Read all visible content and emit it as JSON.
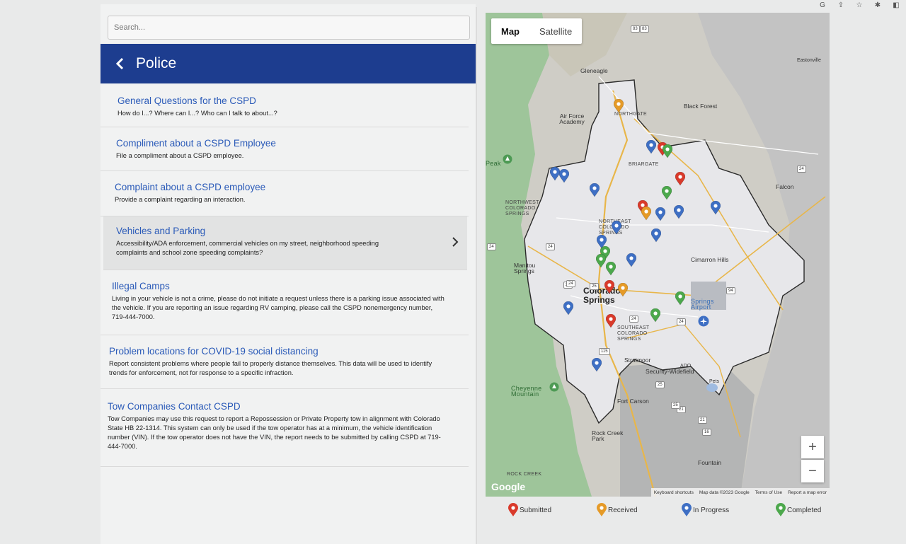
{
  "search": {
    "placeholder": "Search..."
  },
  "header": {
    "title": "Police"
  },
  "items": [
    {
      "title": "General Questions for the CSPD",
      "desc": "How do I...? Where can I...? Who can I talk to about...?"
    },
    {
      "title": "Compliment about a CSPD Employee",
      "desc": "File a compliment about a CSPD employee."
    },
    {
      "title": "Complaint about a CSPD employee",
      "desc": "Provide a complaint regarding an interaction."
    },
    {
      "title": "Vehicles and Parking",
      "desc": "Accessibility/ADA enforcement, commercial vehicles on my street, neighborhood speeding complaints and school zone speeding complaints?"
    },
    {
      "title": "Illegal Camps",
      "desc": "Living in your vehicle is not a crime, please do not initiate a request unless there is a parking issue associated with the vehicle. If you are reporting an issue regarding RV camping, please call the CSPD nonemergency number, 719-444-7000."
    },
    {
      "title": "Problem locations for COVID-19 social distancing",
      "desc": "Report consistent problems where people fail to properly distance themselves. This data will be used to identify trends for enforcement, not for response to a specific infraction."
    },
    {
      "title": "Tow Companies Contact CSPD",
      "desc": "Tow Companies may use this request to report a Repossession or Private Property tow in alignment with Colorado State HB 22-1314. This system can only be used if the tow operator has at a minimum, the vehicle identification number (VIN). If the tow operator does not have the VIN, the report needs to be submitted by calling CSPD at 719-444-7000."
    }
  ],
  "map": {
    "tabs": [
      "Map",
      "Satellite"
    ],
    "zoom_in": "+",
    "zoom_out": "−",
    "google": "Google",
    "attribution": [
      "Keyboard shortcuts",
      "Map data ©2023 Google",
      "Terms of Use",
      "Report a map error"
    ],
    "places": {
      "gleneagle": "Gleneagle",
      "eastonville": "Eastonville",
      "air_force": "Air Force Academy",
      "black_forest": "Black Forest",
      "northgate": "NORTHGATE",
      "briargate": "BRIARGATE",
      "falcon": "Falcon",
      "nw_springs": "NORTHWEST COLORADO SPRINGS",
      "ne_springs": "NORTHEAST COLORADO SPRINGS",
      "manitou": "Manitou Springs",
      "colorado_springs": "Colorado Springs",
      "cimarron": "Cimarron Hills",
      "airport": "Springs Airport",
      "se_springs": "SOUTHEAST COLORADO SPRINGS",
      "stratmoor": "Stratmoor",
      "security_widefield": "Security-Widefield",
      "cheyenne": "Cheyenne Mountain",
      "fort_carson": "Fort Carson",
      "rock_creek": "Rock Creek Park",
      "fountain": "Fountain",
      "rock_creek_small": "ROCK CREEK",
      "peak": "Peak",
      "ado": "ADO",
      "pets": "Pets"
    },
    "route_numbers": [
      "83",
      "24",
      "24",
      "24",
      "25",
      "24",
      "24",
      "115",
      "24",
      "94",
      "25",
      "21",
      "21",
      "16",
      "25",
      "83",
      "24"
    ]
  },
  "legend": [
    {
      "label": "Submitted",
      "color": "#d93a2b"
    },
    {
      "label": "Received",
      "color": "#e59a27"
    },
    {
      "label": "In Progress",
      "color": "#3e6fc4"
    },
    {
      "label": "Completed",
      "color": "#4ca84c"
    }
  ],
  "pins": [
    {
      "status": "Received",
      "color": "#e59a27"
    },
    {
      "status": "In Progress",
      "color": "#3e6fc4"
    },
    {
      "status": "Submitted",
      "color": "#d93a2b"
    },
    {
      "status": "Completed",
      "color": "#4ca84c"
    },
    {
      "status": "In Progress",
      "color": "#3e6fc4"
    },
    {
      "status": "In Progress",
      "color": "#3e6fc4"
    },
    {
      "status": "In Progress",
      "color": "#3e6fc4"
    },
    {
      "status": "Submitted",
      "color": "#d93a2b"
    },
    {
      "status": "Completed",
      "color": "#4ca84c"
    },
    {
      "status": "Submitted",
      "color": "#d93a2b"
    },
    {
      "status": "Received",
      "color": "#e59a27"
    },
    {
      "status": "In Progress",
      "color": "#3e6fc4"
    },
    {
      "status": "In Progress",
      "color": "#3e6fc4"
    },
    {
      "status": "In Progress",
      "color": "#3e6fc4"
    },
    {
      "status": "In Progress",
      "color": "#3e6fc4"
    },
    {
      "status": "In Progress",
      "color": "#3e6fc4"
    },
    {
      "status": "In Progress",
      "color": "#3e6fc4"
    },
    {
      "status": "Completed",
      "color": "#4ca84c"
    },
    {
      "status": "Completed",
      "color": "#4ca84c"
    },
    {
      "status": "Completed",
      "color": "#4ca84c"
    },
    {
      "status": "In Progress",
      "color": "#3e6fc4"
    },
    {
      "status": "Submitted",
      "color": "#d93a2b"
    },
    {
      "status": "Received",
      "color": "#e59a27"
    },
    {
      "status": "In Progress",
      "color": "#3e6fc4"
    },
    {
      "status": "Completed",
      "color": "#4ca84c"
    },
    {
      "status": "Completed",
      "color": "#4ca84c"
    },
    {
      "status": "Submitted",
      "color": "#d93a2b"
    },
    {
      "status": "In Progress",
      "color": "#3e6fc4"
    }
  ]
}
